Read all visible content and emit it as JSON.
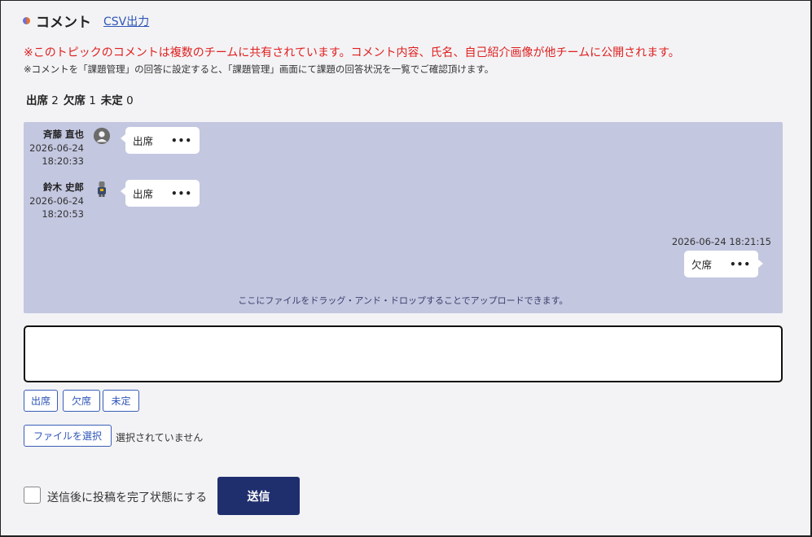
{
  "header": {
    "title": "コメント",
    "csv_link": "CSV出力"
  },
  "notices": {
    "shared_warning": "※このトピックのコメントは複数のチームに共有されています。コメント内容、氏名、自己紹介画像が他チームに公開されます。",
    "answer_hint": "※コメントを「課題管理」の回答に設定すると、「課題管理」画面にて課題の回答状況を一覧でご確認頂けます。"
  },
  "counts": {
    "attend_label": "出席",
    "attend_value": "2",
    "absent_label": "欠席",
    "absent_value": "1",
    "undecided_label": "未定",
    "undecided_value": "0"
  },
  "messages": [
    {
      "name": "斉藤 直也",
      "date": "2026-06-24",
      "time": "18:20:33",
      "text": "出席",
      "menu": "•••"
    },
    {
      "name": "鈴木 史郎",
      "date": "2026-06-24",
      "time": "18:20:53",
      "text": "出席",
      "menu": "•••"
    }
  ],
  "own_message": {
    "timestamp": "2026-06-24 18:21:15",
    "text": "欠席",
    "menu": "•••"
  },
  "drop_hint": "ここにファイルをドラッグ・アンド・ドロップすることでアップロードできます。",
  "quick_buttons": [
    "出席",
    "欠席",
    "未定"
  ],
  "file": {
    "button": "ファイルを選択",
    "status": "選択されていません"
  },
  "complete_checkbox": {
    "label": "送信後に投稿を完了状態にする",
    "checked": false
  },
  "send_button": "送信",
  "colors": {
    "chat_bg": "#c3c7e0",
    "accent": "#1f2f6e",
    "warning": "#e01f1f",
    "link": "#2f56b8"
  }
}
